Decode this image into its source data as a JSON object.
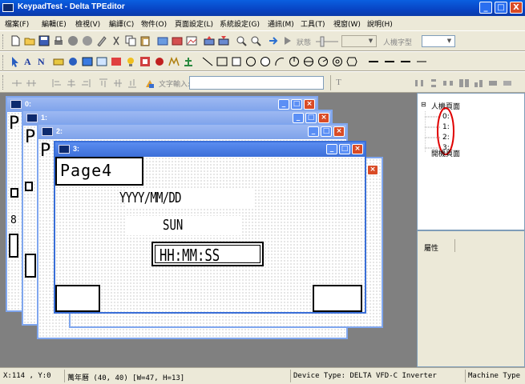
{
  "window": {
    "title": "KeypadTest - Delta TPEditor",
    "buttons": [
      "_",
      "□",
      "X"
    ]
  },
  "menu": [
    "檔案(F)",
    "編輯(E)",
    "檢視(V)",
    "編譯(C)",
    "物件(O)",
    "頁面設定(L)",
    "系統設定(G)",
    "通訊(M)",
    "工具(T)",
    "視窗(W)",
    "說明(H)"
  ],
  "toolbar": {
    "state_label": "狀態",
    "state_value": "",
    "font_label": "人機字型",
    "font_value": "",
    "text_input_label": "文字輸入:",
    "text_input_value": "",
    "text_glyph": "T",
    "keypad_text": "A N"
  },
  "mdi_windows": [
    {
      "title": "0:"
    },
    {
      "title": "1:"
    },
    {
      "title": "2:"
    },
    {
      "title": "3:"
    }
  ],
  "page": {
    "title": "Page4",
    "date": "YYYY/MM/DD",
    "weekday": "SUN",
    "time": "HH:MM:SS"
  },
  "bg_glyphs": {
    "p_letter": "P",
    "eight": "8",
    "colon": ":"
  },
  "tree": {
    "root": "人機頁面",
    "pages": [
      "0:",
      "1:",
      "2:",
      "3:"
    ],
    "startup": "開機頁面",
    "root_toggle": "⊟"
  },
  "properties": {
    "label": "屬性"
  },
  "status": {
    "coords": "X:114 , Y:0",
    "calendar": "萬年曆 (40, 40) [W=47, H=13]",
    "device": "Device Type: DELTA VFD-C Inverter",
    "machine": "Machine Type"
  },
  "colors": {
    "titlebar": "#0844c4",
    "close": "#d94b26",
    "highlight": "#e00000"
  }
}
